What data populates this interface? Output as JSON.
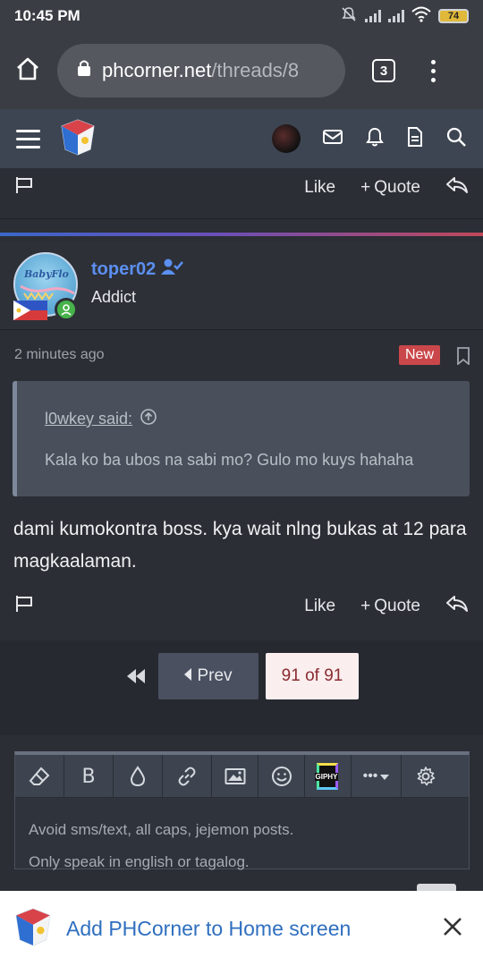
{
  "status": {
    "time": "10:45 PM",
    "battery": "74"
  },
  "browser": {
    "url_host": "phcorner.net",
    "url_path": "/threads/8",
    "tab_count": "3"
  },
  "post_actions": {
    "like": "Like",
    "quote": "Quote"
  },
  "post": {
    "username": "toper02",
    "user_title": "Addict",
    "avatar_text": "BabyFlo",
    "timestamp": "2 minutes ago",
    "badge": "New",
    "quote_author": "l0wkey said:",
    "quote_text": "Kala ko ba ubos na sabi mo? Gulo mo kuys hahaha",
    "body": "dami kumokontra boss. kya wait nlng bukas at 12 para magkaalaman."
  },
  "pagination": {
    "prev": "Prev",
    "current": "91 of 91"
  },
  "editor": {
    "placeholder_line1": "Avoid sms/text, all caps, jejemon posts.",
    "placeholder_line2": "Only speak in english or tagalog.",
    "giphy": "GIPHY"
  },
  "banner": {
    "label": "Add PHCorner to Home screen"
  },
  "colors": {
    "accent_blue": "#5b8ff0",
    "new_badge": "#c9474a",
    "online": "#47b24a"
  }
}
